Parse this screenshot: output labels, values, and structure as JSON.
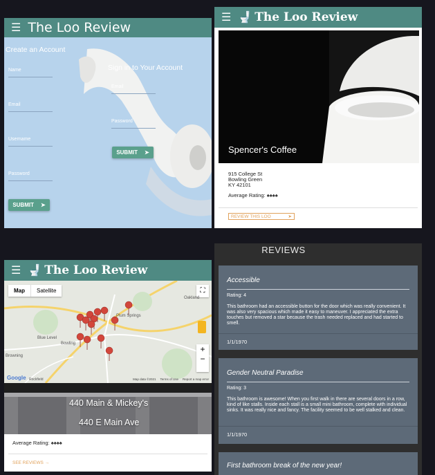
{
  "login": {
    "brand": "The Loo Review",
    "create_heading": "Create an Account",
    "sign_heading": "Sign in to Your Account",
    "create_fields": [
      "Name",
      "Email",
      "Username",
      "Password"
    ],
    "sign_fields": [
      "Email",
      "Password"
    ],
    "submit_label": "SUBMIT"
  },
  "detail": {
    "brand": "The Loo Review",
    "place_name": "Spencer's Coffee",
    "address_lines": [
      "915 College St",
      "Bowling Green",
      "KY 42101"
    ],
    "rating_label": "Average Rating:",
    "review_button": "REVIEW THIS LOO"
  },
  "mapview": {
    "brand": "The Loo Review",
    "tab_map": "Map",
    "tab_satellite": "Satellite",
    "labels": [
      "Plum Springs",
      "Oakland",
      "Blue Level",
      "Bowling",
      "Browning",
      "Rockfield"
    ],
    "footer": [
      "Map data ©2021",
      "Terms of Use",
      "Report a map error"
    ],
    "google": "Google",
    "location_name": "440 Main & Mickey's",
    "location_address": "440 E Main Ave",
    "rating_label": "Average Rating:",
    "see_reviews": "SEE REVIEWS →"
  },
  "reviews": {
    "heading": "REVIEWS",
    "items": [
      {
        "title": "Accessible",
        "rating": "Rating: 4",
        "text": "This bathroom had an accessible button for the door which was really convenient. It was also very spacious which made it easy to maneuver. I appreciated the extra touches but removed a star because the trash needed replaced and had started to smell.",
        "date": "1/1/1970"
      },
      {
        "title": "Gender Neutral Paradise",
        "rating": "Rating: 3",
        "text": "This bathroom is awesome! When you first walk in there are several doors in a row, kind of like stalls. Inside each stall is a small mini bathroom, complete with individual sinks. It was really nice and fancy. The facility seemed to be well stalked and clean.",
        "date": "1/1/1970"
      },
      {
        "title": "First bathroom break of the new year!"
      }
    ]
  },
  "colors": {
    "nav": "#4f8a83",
    "accent": "#e0a15a",
    "card": "#5d6a78"
  }
}
